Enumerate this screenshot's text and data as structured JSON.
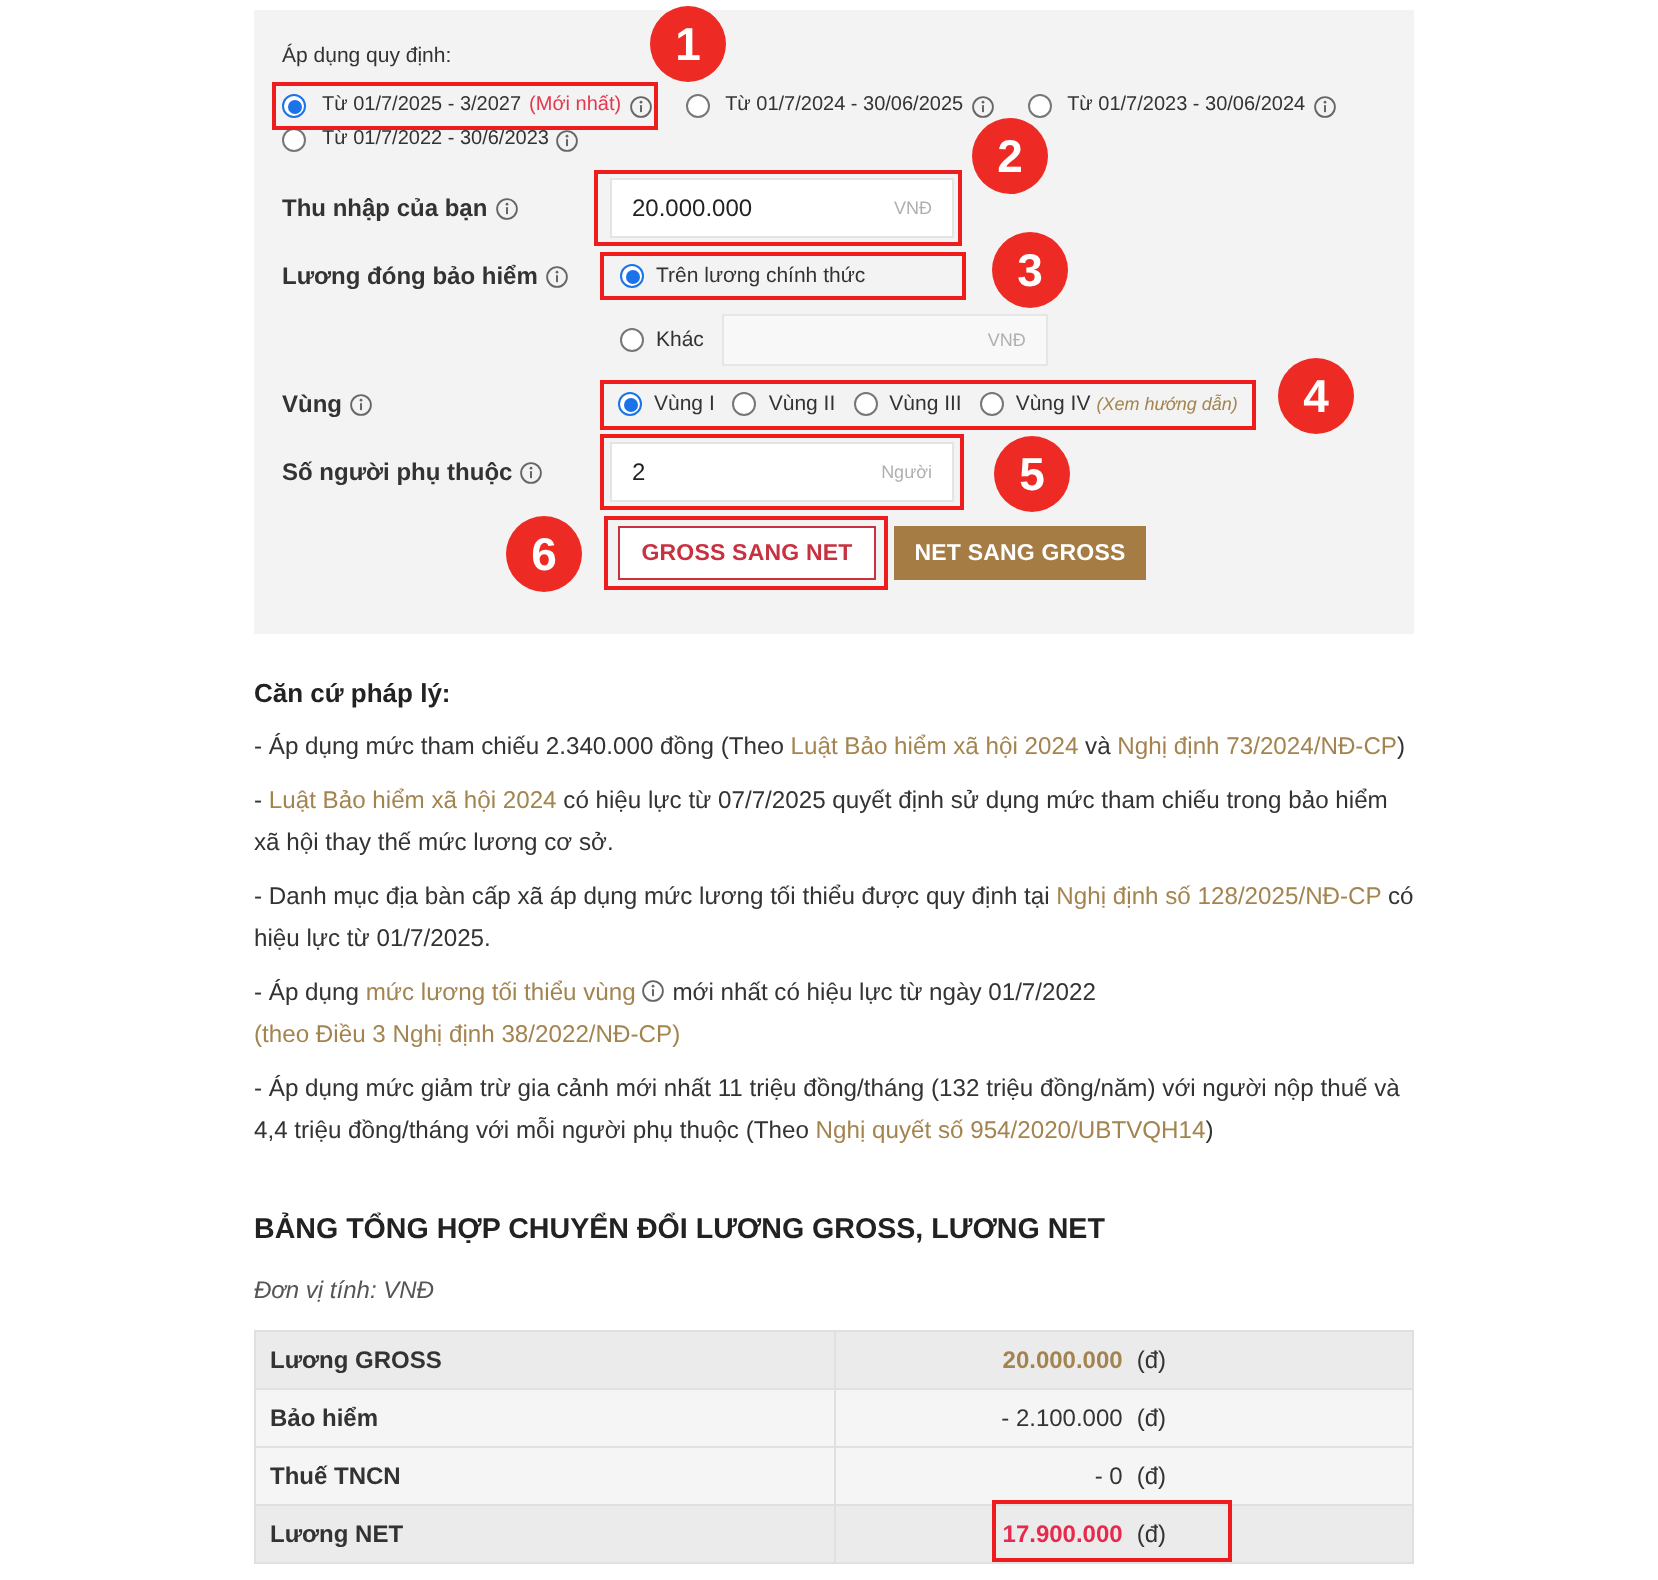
{
  "regulation": {
    "label": "Áp dụng quy định:",
    "options": [
      {
        "label": "Từ 01/7/2025 - 3/2027",
        "tag": "(Mới nhất)",
        "info": true,
        "selected": true,
        "highlighted": true,
        "callout": "1"
      },
      {
        "label": "Từ 01/7/2024 - 30/06/2025",
        "info": true,
        "selected": false,
        "highlighted": false
      },
      {
        "label": "Từ 01/7/2023 - 30/06/2024",
        "info": true,
        "selected": false,
        "highlighted": false
      },
      {
        "label": "Từ 01/7/2022 - 30/6/2023",
        "info": true,
        "selected": false,
        "highlighted": false
      }
    ]
  },
  "income": {
    "label": "Thu nhập của bạn",
    "info": true,
    "value": "20.000.000",
    "unit": "VNĐ",
    "highlighted": true,
    "callout": "2"
  },
  "insurance": {
    "label": "Lương đóng bảo hiểm",
    "info": true,
    "options": [
      {
        "label": "Trên lương chính thức",
        "selected": true,
        "highlighted": true,
        "callout": "3"
      },
      {
        "label": "Khác",
        "selected": false,
        "highlighted": false
      }
    ],
    "other_amount": {
      "unit": "VNĐ",
      "disabled": true
    }
  },
  "region": {
    "label": "Vùng",
    "info": true,
    "options": [
      {
        "label": "Vùng I",
        "selected": true
      },
      {
        "label": "Vùng II",
        "selected": false
      },
      {
        "label": "Vùng III",
        "selected": false
      },
      {
        "label": "Vùng IV",
        "selected": false
      }
    ],
    "guide_link": "(Xem hướng dẫn)",
    "highlighted": true,
    "callout": "4"
  },
  "dependents": {
    "label": "Số người phụ thuộc",
    "info": true,
    "value": "2",
    "unit": "Người",
    "highlighted": true,
    "callout": "5"
  },
  "buttons": [
    {
      "label": "GROSS SANG NET",
      "kind": "outline",
      "highlighted": true,
      "callout": "6"
    },
    {
      "label": "NET SANG GROSS",
      "kind": "filled",
      "highlighted": false
    }
  ],
  "legal": {
    "title": "Căn cứ pháp lý:",
    "paragraphs": [
      [
        {
          "kind": "text",
          "text": "- Áp dụng mức tham chiếu 2.340.000 đồng (Theo "
        },
        {
          "kind": "link",
          "text": "Luật Bảo hiểm xã hội 2024"
        },
        {
          "kind": "text",
          "text": " và "
        },
        {
          "kind": "link",
          "text": "Nghị định 73/2024/NĐ-CP"
        },
        {
          "kind": "text",
          "text": ")"
        }
      ],
      [
        {
          "kind": "text",
          "text": "- "
        },
        {
          "kind": "link",
          "text": "Luật Bảo hiểm xã hội 2024"
        },
        {
          "kind": "text",
          "text": " có hiệu lực từ 07/7/2025 quyết định sử dụng mức tham chiếu trong bảo hiểm xã hội thay thế mức lương cơ sở."
        }
      ],
      [
        {
          "kind": "text",
          "text": "- Danh mục địa bàn cấp xã áp dụng mức lương tối thiểu được quy định tại "
        },
        {
          "kind": "link",
          "text": "Nghị định số 128/2025/NĐ-CP"
        },
        {
          "kind": "text",
          "text": " có hiệu lực từ 01/7/2025."
        }
      ],
      [
        {
          "kind": "text",
          "text": "- Áp dụng "
        },
        {
          "kind": "link",
          "text": "mức lương tối thiểu vùng",
          "info": true
        },
        {
          "kind": "text",
          "text": " mới nhất có hiệu lực từ ngày 01/7/2022 "
        },
        {
          "kind": "link",
          "text": "(theo Điều 3 Nghị định 38/2022/NĐ-CP)"
        }
      ],
      [
        {
          "kind": "text",
          "text": "- Áp dụng mức giảm trừ gia cảnh mới nhất 11 triệu đồng/tháng (132 triệu đồng/năm) với người nộp thuế và 4,4 triệu đồng/tháng với mỗi người phụ thuộc (Theo "
        },
        {
          "kind": "link",
          "text": "Nghị quyết số 954/2020/UBTVQH14"
        },
        {
          "kind": "text",
          "text": ")"
        }
      ]
    ]
  },
  "summary": {
    "title": "BẢNG TỔNG HỢP CHUYỂN ĐỔI LƯƠNG GROSS, LƯƠNG NET",
    "unit_note": "Đơn vị tính: VNĐ",
    "rows": [
      {
        "label": "Lương GROSS",
        "value": "20.000.000",
        "unit": "(đ)",
        "kind": "gross",
        "highlighted": false
      },
      {
        "label": "Bảo hiểm",
        "value": "- 2.100.000",
        "unit": "(đ)",
        "kind": "deduction",
        "highlighted": false
      },
      {
        "label": "Thuế TNCN",
        "value": "- 0",
        "unit": "(đ)",
        "kind": "deduction",
        "highlighted": false
      },
      {
        "label": "Lương NET",
        "value": "17.900.000",
        "unit": "(đ)",
        "kind": "net",
        "highlighted": true
      }
    ]
  }
}
